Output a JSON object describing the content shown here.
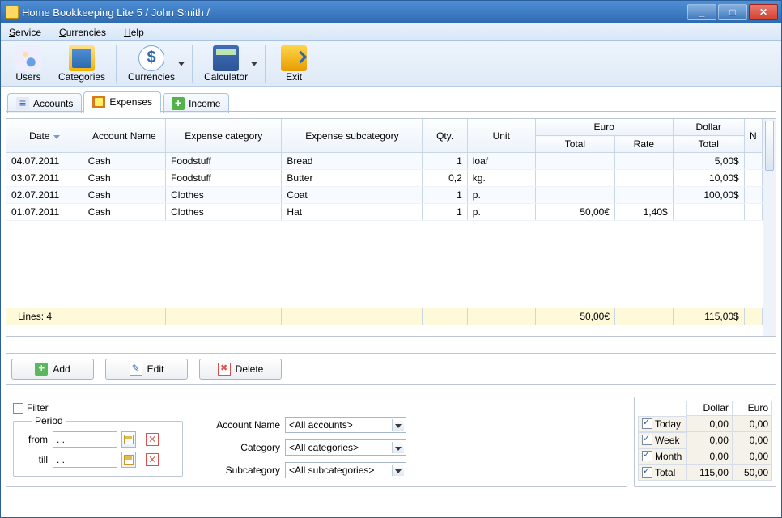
{
  "window": {
    "title": "Home Bookkeeping Lite 5  / John Smith /"
  },
  "menubar": {
    "items": [
      "Service",
      "Currencies",
      "Help"
    ]
  },
  "toolbar": {
    "users": "Users",
    "categories": "Categories",
    "currencies": "Currencies",
    "calculator": "Calculator",
    "exit": "Exit"
  },
  "tabs": {
    "accounts": "Accounts",
    "expenses": "Expenses",
    "income": "Income",
    "active_index": 1
  },
  "grid": {
    "header": {
      "date": "Date",
      "account_name": "Account Name",
      "expense_category": "Expense category",
      "expense_subcategory": "Expense subcategory",
      "qty": "Qty.",
      "unit": "Unit",
      "euro_group": "Euro",
      "euro_total": "Total",
      "euro_rate": "Rate",
      "dollar_group": "Dollar",
      "dollar_total": "Total",
      "n": "N"
    },
    "rows": [
      {
        "date": "04.07.2011",
        "account": "Cash",
        "category": "Foodstuff",
        "subcategory": "Bread",
        "qty": "1",
        "unit": "loaf",
        "euro_total": "",
        "rate": "",
        "dollar_total": "5,00$"
      },
      {
        "date": "03.07.2011",
        "account": "Cash",
        "category": "Foodstuff",
        "subcategory": "Butter",
        "qty": "0,2",
        "unit": "kg.",
        "euro_total": "",
        "rate": "",
        "dollar_total": "10,00$"
      },
      {
        "date": "02.07.2011",
        "account": "Cash",
        "category": "Clothes",
        "subcategory": "Coat",
        "qty": "1",
        "unit": "p.",
        "euro_total": "",
        "rate": "",
        "dollar_total": "100,00$"
      },
      {
        "date": "01.07.2011",
        "account": "Cash",
        "category": "Clothes",
        "subcategory": "Hat",
        "qty": "1",
        "unit": "p.",
        "euro_total": "50,00€",
        "rate": "1,40$",
        "dollar_total": ""
      }
    ],
    "footer": {
      "lines_label": "Lines: 4",
      "euro_total": "50,00€",
      "dollar_total": "115,00$"
    }
  },
  "actions": {
    "add": "Add",
    "edit": "Edit",
    "delete": "Delete"
  },
  "filter": {
    "checkbox_label": "Filter",
    "period_legend": "Period",
    "from_label": "from",
    "till_label": "till",
    "date_placeholder": ".  .",
    "account_label": "Account Name",
    "category_label": "Category",
    "subcategory_label": "Subcategory",
    "account_value": "<All accounts>",
    "category_value": "<All categories>",
    "subcategory_value": "<All subcategories>"
  },
  "summary": {
    "col_dollar": "Dollar",
    "col_euro": "Euro",
    "rows": [
      {
        "label": "Today",
        "dollar": "0,00",
        "euro": "0,00"
      },
      {
        "label": "Week",
        "dollar": "0,00",
        "euro": "0,00"
      },
      {
        "label": "Month",
        "dollar": "0,00",
        "euro": "0,00"
      },
      {
        "label": "Total",
        "dollar": "115,00",
        "euro": "50,00"
      }
    ]
  }
}
